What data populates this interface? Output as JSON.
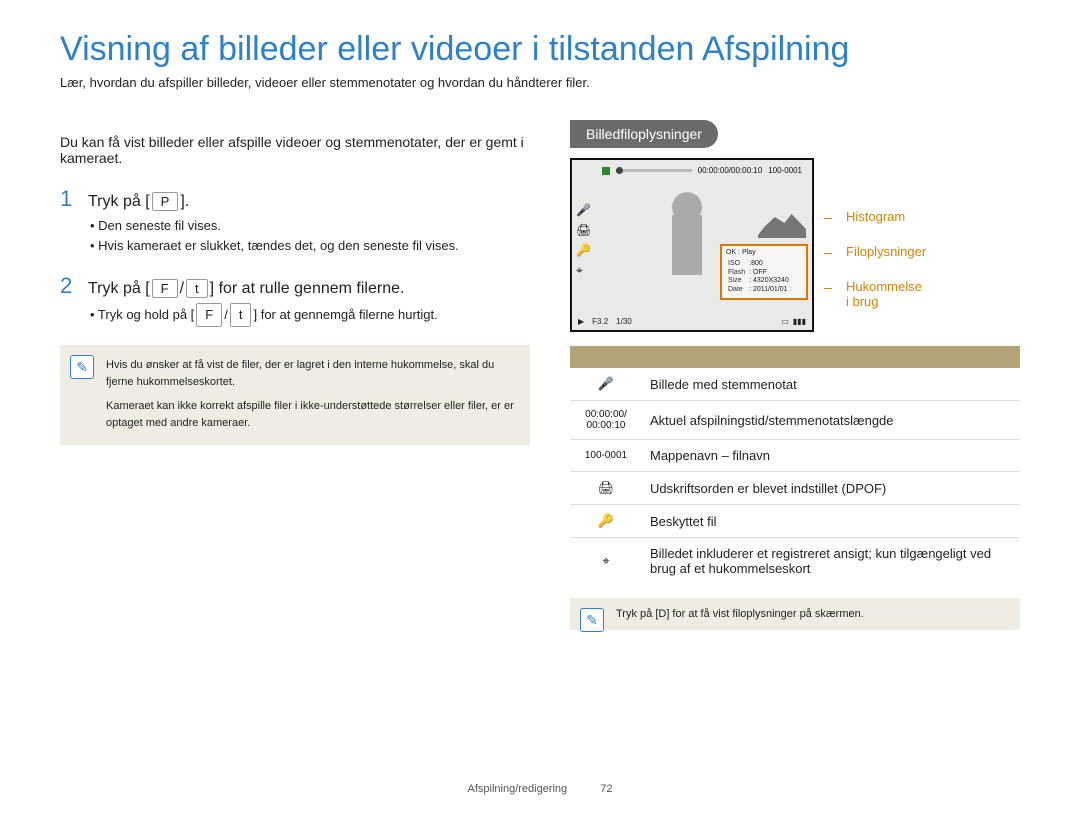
{
  "title": "Visning af billeder eller videoer i tilstanden Afspilning",
  "subtitle": "Lær, hvordan du afspiller billeder, videoer eller stemmenotater og hvordan du håndterer filer.",
  "left": {
    "intro": "Du kan få vist billeder eller afspille videoer og stemmenotater, der er gemt i kameraet.",
    "step1": {
      "pre": "Tryk på [",
      "key": "P",
      "post": "].",
      "sub": "• Den seneste fil vises.\n• Hvis kameraet er slukket, tændes det, og den seneste fil vises."
    },
    "step2": {
      "pre": "Tryk på [",
      "key1": "F",
      "mid": "/",
      "key2": "t",
      "post": "] for at rulle gennem filerne.",
      "sub_pre": "• Tryk og hold på [",
      "sub_key1": "F",
      "sub_mid": "/",
      "sub_key2": "t",
      "sub_post": "] for at gennemgå filerne hurtigt."
    },
    "note1": "Hvis du ønsker at få vist de filer, der er lagret i den interne hukommelse, skal du fjerne hukommelseskortet.",
    "note2": "Kameraet kan ikke korrekt afspille filer i ikke-understøttede størrelser eller filer, er er optaget med andre kameraer."
  },
  "right": {
    "tab": "Billedfiloplysninger",
    "callouts": {
      "histogram": "Histogram",
      "fileinfo": "Filoplysninger",
      "memory": "Hukommelse i brug"
    },
    "cam": {
      "time": "00:00:00/00:00:10",
      "folder": "100-0001",
      "okplay": "OK : Play",
      "iso_l": "ISO",
      "iso_v": ":800",
      "flash_l": "Flash",
      "flash_v": ": OFF",
      "size_l": "Size",
      "size_v": ": 4320X3240",
      "date_l": "Date",
      "date_v": ": 2011/01/01",
      "fnum": "F3.2",
      "shutter": "1/30"
    },
    "legend": [
      {
        "ico": "🎤",
        "desc": "Billede med stemmenotat"
      },
      {
        "ico": "00:00:00/\n00:00:10",
        "desc": "Aktuel afspilningstid/stemmenotatslængde"
      },
      {
        "ico": "100-0001",
        "desc": "Mappenavn – filnavn"
      },
      {
        "ico": "🖨",
        "desc": "Udskriftsorden er blevet indstillet (DPOF)"
      },
      {
        "ico": "🔑",
        "desc": "Beskyttet fil"
      },
      {
        "ico": "⌖",
        "desc": "Billedet inkluderer et registreret ansigt; kun tilgængeligt ved brug af et hukommelseskort"
      }
    ],
    "tip": "Tryk på [D] for at få vist filoplysninger på skærmen."
  },
  "footer": {
    "section": "Afspilning/redigering",
    "page": "72"
  }
}
